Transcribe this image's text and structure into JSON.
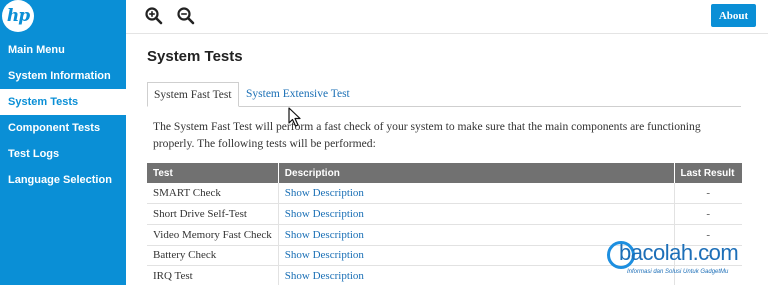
{
  "logo": {
    "text": "hp"
  },
  "sidebar": {
    "items": [
      {
        "label": "Main Menu"
      },
      {
        "label": "System Information"
      },
      {
        "label": "System Tests"
      },
      {
        "label": "Component Tests"
      },
      {
        "label": "Test Logs"
      },
      {
        "label": "Language Selection"
      }
    ],
    "active_index": 2
  },
  "toolbar": {
    "zoom_in_icon": "zoom-in-icon",
    "zoom_out_icon": "zoom-out-icon",
    "about_label": "About"
  },
  "main": {
    "title": "System Tests",
    "tabs": [
      {
        "label": "System Fast Test"
      },
      {
        "label": "System Extensive Test"
      }
    ],
    "description": "The System Fast Test will perform a fast check of your system to make sure that the main components are functioning properly. The following tests will be performed:",
    "table": {
      "headers": [
        "Test",
        "Description",
        "Last Result"
      ],
      "rows": [
        {
          "test": "SMART Check",
          "description": "Show Description",
          "result": "-"
        },
        {
          "test": "Short Drive Self-Test",
          "description": "Show Description",
          "result": "-"
        },
        {
          "test": "Video Memory Fast Check",
          "description": "Show Description",
          "result": "-"
        },
        {
          "test": "Battery Check",
          "description": "Show Description",
          "result": "-"
        },
        {
          "test": "IRQ Test",
          "description": "Show Description",
          "result": ""
        }
      ]
    }
  },
  "watermark": {
    "brand": "bacolah.com",
    "tagline": "Informasi dan Solusi Untuk GadgetMu"
  },
  "colors": {
    "accent": "#0a8fd6",
    "link": "#1a6fb5",
    "table_header": "#717171"
  }
}
